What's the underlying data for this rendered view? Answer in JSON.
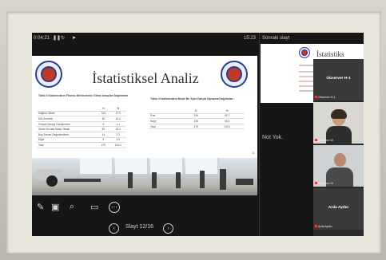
{
  "presenter": {
    "elapsed": "0:04:21",
    "clock": "15:23",
    "next_slide_label": "Sonraki slayt",
    "notes_text": "Not Yok.",
    "slide_counter": "Slayt 12/16"
  },
  "slide": {
    "title": "İstatistiksel Analiz",
    "page_number": "11",
    "table1": {
      "caption": "Tablo 3 Katılımcıların Fitness Merkezlerine Gitme Amaçları Dağılımları",
      "headers": [
        "",
        "N",
        "%"
      ],
      "rows": [
        [
          "Sağlıklı Olmak",
          "313",
          "27.9"
        ],
        [
          "Kilo Kontrolü",
          "46",
          "10.3"
        ],
        [
          "Sosyal Çevreyi Genişletmek",
          "5",
          "1.1"
        ],
        [
          "Güzel Vücuda Sahip Olmak",
          "82",
          "18.3"
        ],
        [
          "Boş Zaman Değerlendirme",
          "14",
          "3.1"
        ],
        [
          "Diğer",
          "9",
          "4.5"
        ],
        [
          "Total",
          "479",
          "100.0"
        ]
      ]
    },
    "table2": {
      "caption": "Tablo 4 Katılımcıların Beşle Bir Spor Dalıyla Uğraşma Dağılımları",
      "headers": [
        "",
        "N",
        "%"
      ],
      "rows": [
        [
          "Evet",
          "194",
          "41.7"
        ],
        [
          "Hayır",
          "240",
          "58.3"
        ],
        [
          "Total",
          "479",
          "100.0"
        ]
      ]
    }
  },
  "next_slide": {
    "title": "İstatistiks"
  },
  "toolbar": {
    "pen_icon": "✎",
    "slides_icon": "▣",
    "zoom_icon": "⌕",
    "screen_icon": "▭",
    "more_icon": "⋯",
    "prev_icon": "‹",
    "next_icon": "›"
  },
  "participants": [
    {
      "name": "Observer H-1",
      "sub": "Observer H-1"
    },
    {
      "name": "",
      "sub": "Katılımcı 42"
    },
    {
      "name": "",
      "sub": "Katılımcı 19"
    },
    {
      "name": "Arda Aydın",
      "sub": "Arda Aydın"
    }
  ]
}
